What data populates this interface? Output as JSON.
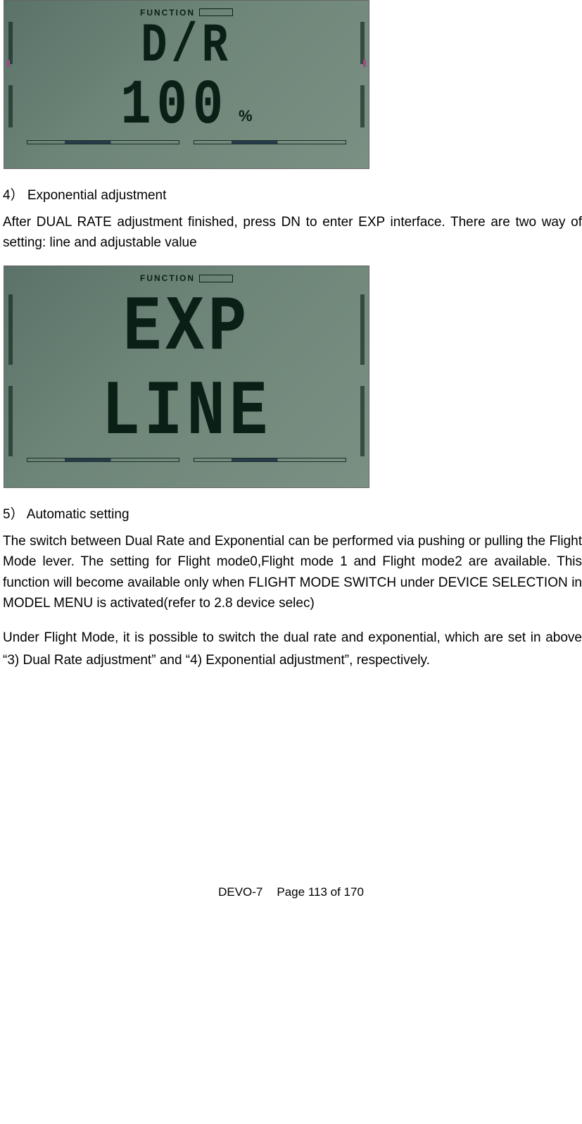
{
  "lcd1": {
    "func": "FUNCTION",
    "line1": "D/R",
    "line2": "100",
    "pct": "%"
  },
  "section4": {
    "heading": "4） Exponential adjustment",
    "para": "After DUAL RATE adjustment finished, press DN to enter EXP interface. There are two way of setting: line and adjustable value"
  },
  "lcd2": {
    "func": "FUNCTION",
    "line1": "EXP",
    "line2": "LINE"
  },
  "section5": {
    "heading": "5） Automatic setting",
    "para1": "The switch between Dual Rate and Exponential can be performed via pushing or pulling the Flight Mode lever. The setting for Flight mode0,Flight mode 1 and Flight mode2 are available. This function will become available only when FLIGHT MODE SWITCH under DEVICE SELECTION in MODEL MENU is activated(refer to 2.8 device selec)",
    "para2": "Under Flight Mode, it is possible to switch the dual rate and exponential, which are set in above “3) Dual Rate adjustment” and “4) Exponential adjustment”, respectively."
  },
  "footer": {
    "model": "DEVO-7",
    "page": "Page 113 of 170"
  }
}
